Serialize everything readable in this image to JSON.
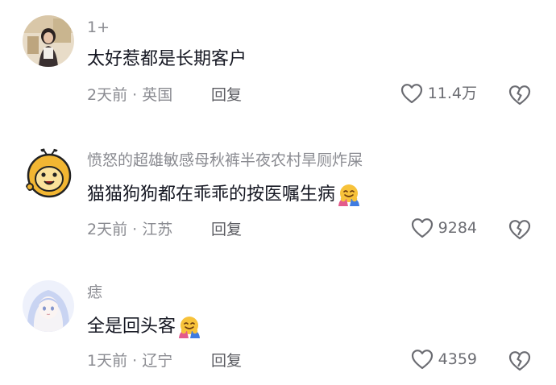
{
  "comments": [
    {
      "username": "1+",
      "text": "太好惹都是长期客户",
      "time": "2天前",
      "separator": "·",
      "location": "英国",
      "reply_label": "回复",
      "likes": "11.4万",
      "avatar": "photo-avatar",
      "emoji": null
    },
    {
      "username": "愤怒的超雄敏感母秋裤半夜农村旱厕炸屎",
      "text": "猫猫狗狗都在乖乖的按医嘱生病",
      "time": "2天前",
      "separator": "·",
      "location": "江苏",
      "reply_label": "回复",
      "likes": "9284",
      "avatar": "cartoon-avatar",
      "emoji": "hugging-face-emoji"
    },
    {
      "username": "痣",
      "text": "全是回头客",
      "time": "1天前",
      "separator": "·",
      "location": "辽宁",
      "reply_label": "回复",
      "likes": "4359",
      "avatar": "anime-avatar",
      "emoji": "hugging-face-emoji"
    }
  ],
  "icons": {
    "like": "heart-outline-icon",
    "dislike": "broken-heart-icon"
  },
  "colors": {
    "primary_text": "#161823",
    "secondary_text": "#8a8b91",
    "icon": "#6b6c72"
  }
}
